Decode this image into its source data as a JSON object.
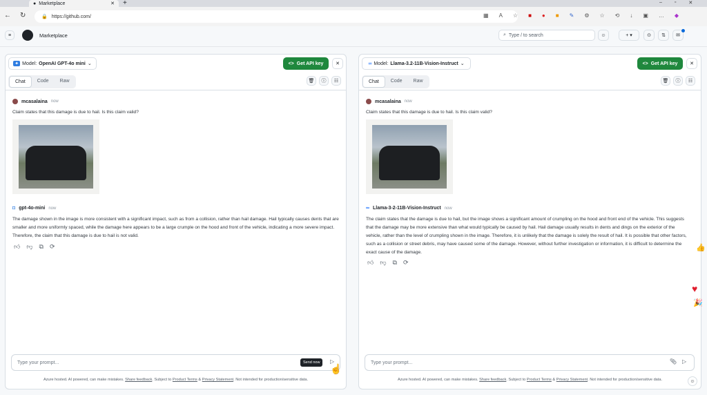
{
  "browser": {
    "tab_title": "Marketplace",
    "url": "https://github.com/"
  },
  "github": {
    "title": "Marketplace",
    "search_placeholder": "Type / to search"
  },
  "panels": [
    {
      "model_label": "Model:",
      "model": "OpenAI GPT-4o mini",
      "api_button": "Get API key",
      "tabs": [
        "Chat",
        "Code",
        "Raw"
      ],
      "user": "mcasalaina",
      "user_time": "now",
      "prompt": "Claim states that this damage is due to hail. Is this claim valid?",
      "bot": "gpt-4o-mini",
      "bot_time": "now",
      "response": "The damage shown in the image is more consistent with a significant impact, such as from a collision, rather than hail damage. Hail typically causes dents that are smaller and more uniformly spaced, while the damage here appears to be a large crumple on the hood and front of the vehicle, indicating a more severe impact. Therefore, the claim that this damage is due to hail is not valid.",
      "input_placeholder": "Type your prompt...",
      "send_tooltip": "Send now"
    },
    {
      "model_label": "Model:",
      "model": "Llama-3.2-11B-Vision-Instruct",
      "api_button": "Get API key",
      "tabs": [
        "Chat",
        "Code",
        "Raw"
      ],
      "user": "mcasalaina",
      "user_time": "now",
      "prompt": "Claim states that this damage is due to hail. Is this claim valid?",
      "bot": "Llama-3-2-11B-Vision-Instruct",
      "bot_time": "now",
      "response": "The claim states that the damage is due to hail, but the image shows a significant amount of crumpling on the hood and front end of the vehicle. This suggests that the damage may be more extensive than what would typically be caused by hail. Hail damage usually results in dents and dings on the exterior of the vehicle, rather than the level of crumpling shown in the image. Therefore, it is unlikely that the damage is solely the result of hail. It is possible that other factors, such as a collision or street debris, may have caused some of the damage. However, without further investigation or information, it is difficult to determine the exact cause of the damage.",
      "input_placeholder": "Type your prompt..."
    }
  ],
  "footer": {
    "text1": "Azure hosted. AI powered, can make mistakes.",
    "feedback": "Share feedback",
    "text2": ". Subject to",
    "terms": "Product Terms",
    "amp": "&",
    "privacy": "Privacy Statement",
    "text3": ". Not intended for production/sensitive data."
  }
}
